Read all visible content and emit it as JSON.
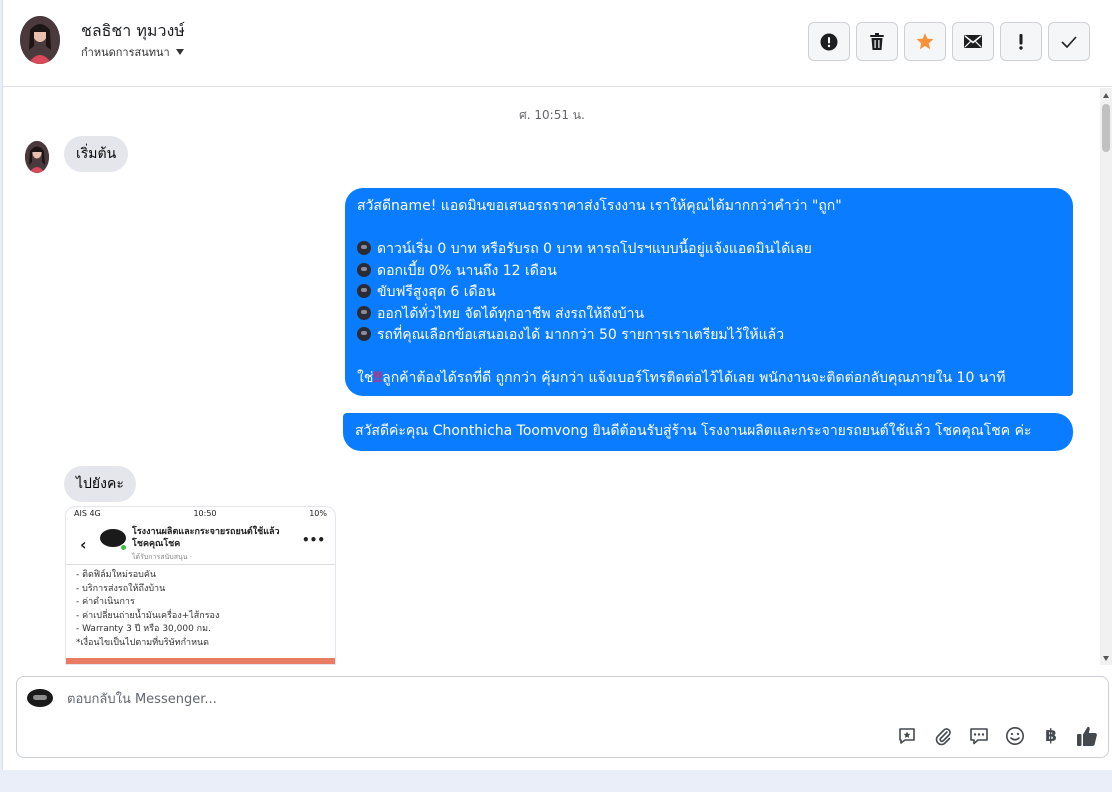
{
  "header": {
    "contact_name": "ชลธิชา ทุมวงษ์",
    "assign_label": "กำหนดการสนทนา",
    "buttons": [
      {
        "name": "mark-spam",
        "icon": "exclamation-circle-icon"
      },
      {
        "name": "delete",
        "icon": "trash-icon"
      },
      {
        "name": "star",
        "icon": "star-icon",
        "color": "#f7923b"
      },
      {
        "name": "mark-unread",
        "icon": "envelope-icon"
      },
      {
        "name": "important",
        "icon": "exclamation-icon"
      },
      {
        "name": "mark-done",
        "icon": "check-icon"
      }
    ]
  },
  "conversation": {
    "timestamp": "ศ. 10:51 น.",
    "incoming_1": "เริ่มต้น",
    "outgoing_1": {
      "intro": "สวัสดีname! แอดมินขอเสนอรถราคาส่งโรงงาน เราให้คุณได้มากกว่าคำว่า \"ถูก\"",
      "bullets": [
        "ดาวน์เริ่ม 0 บาท หรือรับรถ 0 บาท หารถโปรฯแบบนี้อยู่แจ้งแอดมินได้เลย",
        "ดอกเบี้ย 0% นานถึง 12 เดือน",
        "ขับฟรีสูงสุด 6 เดือน",
        "ออกได้ทั่วไทย จัดได้ทุกอาชีพ ส่งรถให้ถึงบ้าน",
        "รถที่คุณเลือกข้อเสนอเองได้ มากกว่า 50 รายการเราเตรียมไว้ให้แล้ว"
      ],
      "closing_prefix": "ใช่",
      "closing_mark": "‼",
      "closing_rest": "ลูกค้าต้องได้รถที่ดี ถูกกว่า คุ้มกว่า แจ้งเบอร์โทรติดต่อไว้ได้เลย พนักงานจะติดต่อกลับคุณภายใน 10 นาที"
    },
    "outgoing_2": "สวัสดีค่ะคุณ Chonthicha Toomvong ยินดีต้อนรับสู่ร้าน โรงงานผลิตและกระจายรถยนต์ใช้แล้ว โชคคุณโชค ค่ะ",
    "incoming_2": "ไปยังคะ",
    "attachment": {
      "status_left": "AIS 4G",
      "status_time": "10:50",
      "status_right": "10%",
      "page_name_line1": "โรงงานผลิตและกระจายรถยนต์ใช้แล้ว",
      "page_name_line2": "โชคคุณโชค",
      "page_sub": "ได้รับการสนับสนุน ·",
      "list": [
        "- ติดฟิล์มใหม่รอบคัน",
        "- บริการส่งรถให้ถึงบ้าน",
        "- ค่าดำเนินการ",
        "- ค่าเปลี่ยนถ่ายน้ำมันเครื่อง+ไส้กรอง",
        "- Warranty 3 ปี หรือ 30,000 กม.",
        "*เงื่อนไขเป็นไปตามที่บริษัทกำหนด"
      ]
    }
  },
  "composer": {
    "placeholder": "ตอบกลับใน Messenger...",
    "tools": [
      "saved-reply-icon",
      "paperclip-icon",
      "chat-bubbles-icon",
      "emoji-icon",
      "baht-icon",
      "thumbs-up-icon"
    ],
    "baht_symbol": "฿"
  }
}
